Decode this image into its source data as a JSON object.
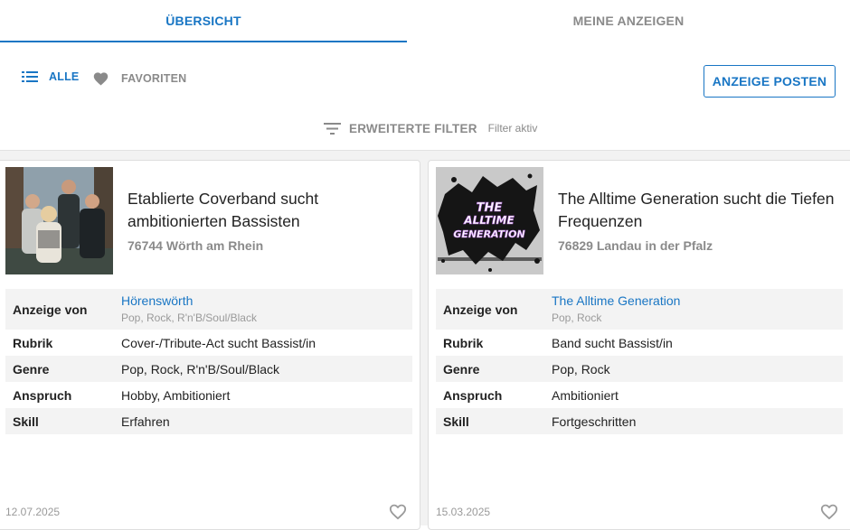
{
  "tabs": [
    {
      "label": "ÜBERSICHT",
      "active": true
    },
    {
      "label": "MEINE ANZEIGEN",
      "active": false
    }
  ],
  "filters": {
    "all_label": "ALLE",
    "favorites_label": "FAVORITEN",
    "post_button": "ANZEIGE POSTEN",
    "advanced_label": "ERWEITERTE FILTER",
    "advanced_status": "Filter aktiv"
  },
  "icons": {
    "all": "list-icon",
    "favorites": "heart-filled-icon",
    "advanced": "filter-lines-icon",
    "card_favorite": "heart-outline-icon"
  },
  "colors": {
    "accent": "#1976c4",
    "muted": "#8a8a8a",
    "row_alt": "#f3f3f3"
  },
  "cards": [
    {
      "title": "Etablierte Coverband sucht ambitionierten Bassisten",
      "location": "76744 Wörth am Rhein",
      "image": "band-photo",
      "owner_label": "Anzeige von",
      "owner_name": "Hörenswörth",
      "owner_genres": "Pop, Rock, R'n'B/Soul/Black",
      "rows": [
        {
          "label": "Rubrik",
          "value": "Cover-/Tribute-Act sucht Bassist/in"
        },
        {
          "label": "Genre",
          "value": "Pop, Rock, R'n'B/Soul/Black"
        },
        {
          "label": "Anspruch",
          "value": "Hobby, Ambitioniert"
        },
        {
          "label": "Skill",
          "value": "Erfahren"
        }
      ],
      "date": "12.07.2025"
    },
    {
      "title": "The Alltime Generation sucht die Tiefen Frequenzen",
      "location": "76829 Landau in der Pfalz",
      "image": "band-logo",
      "logo_text_1": "THE",
      "logo_text_2": "ALLTIME",
      "logo_text_3": "GENERATION",
      "owner_label": "Anzeige von",
      "owner_name": "The Alltime Generation",
      "owner_genres": "Pop, Rock",
      "rows": [
        {
          "label": "Rubrik",
          "value": "Band sucht Bassist/in"
        },
        {
          "label": "Genre",
          "value": "Pop, Rock"
        },
        {
          "label": "Anspruch",
          "value": "Ambitioniert"
        },
        {
          "label": "Skill",
          "value": "Fortgeschritten"
        }
      ],
      "date": "15.03.2025"
    }
  ]
}
